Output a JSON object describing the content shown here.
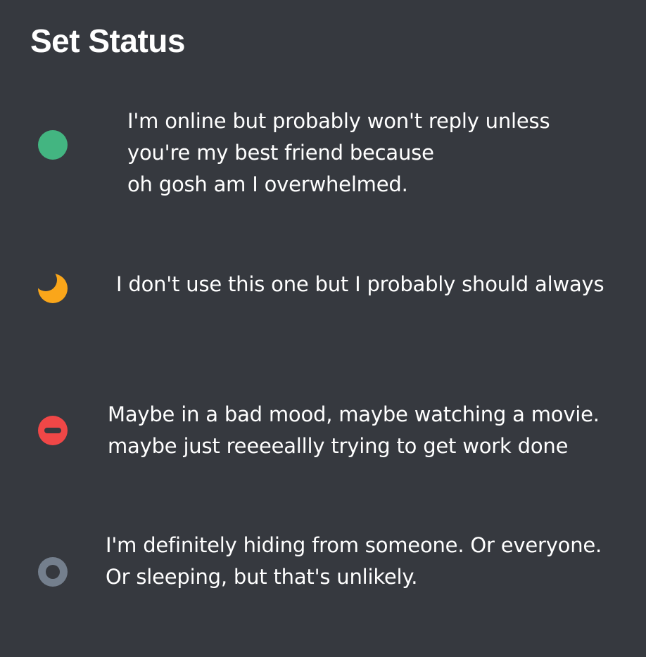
{
  "header": {
    "title": "Set Status"
  },
  "statuses": [
    {
      "id": "online",
      "icon": "online-status-icon",
      "color": "#43b581",
      "lines": [
        "I'm online but probably won't reply unless",
        "you're my best friend because",
        "oh gosh am I overwhelmed."
      ]
    },
    {
      "id": "idle",
      "icon": "idle-moon-icon",
      "color": "#faa61a",
      "lines": [
        "I don't use this one but I probably should always"
      ]
    },
    {
      "id": "dnd",
      "icon": "do-not-disturb-icon",
      "color": "#f04747",
      "lines": [
        "Maybe in a bad mood, maybe watching a movie.",
        "maybe just reeeeallly trying to get work done"
      ]
    },
    {
      "id": "invisible",
      "icon": "invisible-status-icon",
      "color": "#747f8d",
      "lines": [
        "I'm definitely hiding from someone. Or everyone.",
        "Or sleeping, but that's unlikely."
      ]
    }
  ],
  "colors": {
    "background": "#36393f",
    "text": "#ffffff"
  }
}
